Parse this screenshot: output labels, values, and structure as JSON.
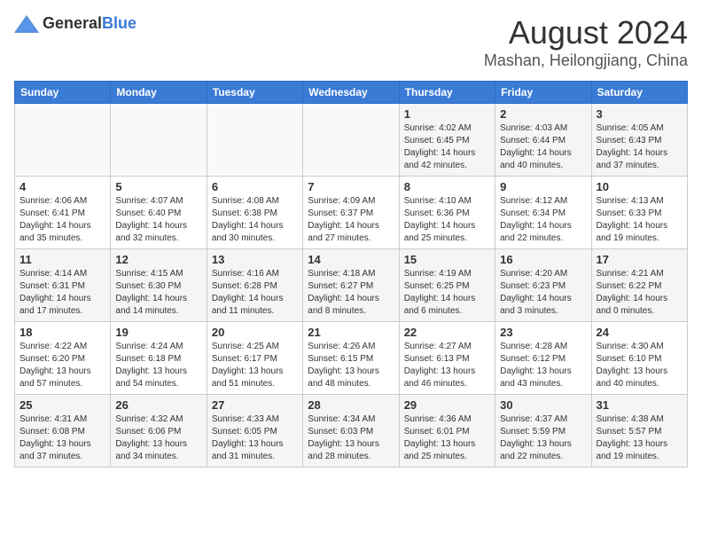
{
  "header": {
    "logo_general": "General",
    "logo_blue": "Blue",
    "month_year": "August 2024",
    "location": "Mashan, Heilongjiang, China"
  },
  "weekdays": [
    "Sunday",
    "Monday",
    "Tuesday",
    "Wednesday",
    "Thursday",
    "Friday",
    "Saturday"
  ],
  "weeks": [
    [
      {
        "day": "",
        "info": ""
      },
      {
        "day": "",
        "info": ""
      },
      {
        "day": "",
        "info": ""
      },
      {
        "day": "",
        "info": ""
      },
      {
        "day": "1",
        "info": "Sunrise: 4:02 AM\nSunset: 6:45 PM\nDaylight: 14 hours and 42 minutes."
      },
      {
        "day": "2",
        "info": "Sunrise: 4:03 AM\nSunset: 6:44 PM\nDaylight: 14 hours and 40 minutes."
      },
      {
        "day": "3",
        "info": "Sunrise: 4:05 AM\nSunset: 6:43 PM\nDaylight: 14 hours and 37 minutes."
      }
    ],
    [
      {
        "day": "4",
        "info": "Sunrise: 4:06 AM\nSunset: 6:41 PM\nDaylight: 14 hours and 35 minutes."
      },
      {
        "day": "5",
        "info": "Sunrise: 4:07 AM\nSunset: 6:40 PM\nDaylight: 14 hours and 32 minutes."
      },
      {
        "day": "6",
        "info": "Sunrise: 4:08 AM\nSunset: 6:38 PM\nDaylight: 14 hours and 30 minutes."
      },
      {
        "day": "7",
        "info": "Sunrise: 4:09 AM\nSunset: 6:37 PM\nDaylight: 14 hours and 27 minutes."
      },
      {
        "day": "8",
        "info": "Sunrise: 4:10 AM\nSunset: 6:36 PM\nDaylight: 14 hours and 25 minutes."
      },
      {
        "day": "9",
        "info": "Sunrise: 4:12 AM\nSunset: 6:34 PM\nDaylight: 14 hours and 22 minutes."
      },
      {
        "day": "10",
        "info": "Sunrise: 4:13 AM\nSunset: 6:33 PM\nDaylight: 14 hours and 19 minutes."
      }
    ],
    [
      {
        "day": "11",
        "info": "Sunrise: 4:14 AM\nSunset: 6:31 PM\nDaylight: 14 hours and 17 minutes."
      },
      {
        "day": "12",
        "info": "Sunrise: 4:15 AM\nSunset: 6:30 PM\nDaylight: 14 hours and 14 minutes."
      },
      {
        "day": "13",
        "info": "Sunrise: 4:16 AM\nSunset: 6:28 PM\nDaylight: 14 hours and 11 minutes."
      },
      {
        "day": "14",
        "info": "Sunrise: 4:18 AM\nSunset: 6:27 PM\nDaylight: 14 hours and 8 minutes."
      },
      {
        "day": "15",
        "info": "Sunrise: 4:19 AM\nSunset: 6:25 PM\nDaylight: 14 hours and 6 minutes."
      },
      {
        "day": "16",
        "info": "Sunrise: 4:20 AM\nSunset: 6:23 PM\nDaylight: 14 hours and 3 minutes."
      },
      {
        "day": "17",
        "info": "Sunrise: 4:21 AM\nSunset: 6:22 PM\nDaylight: 14 hours and 0 minutes."
      }
    ],
    [
      {
        "day": "18",
        "info": "Sunrise: 4:22 AM\nSunset: 6:20 PM\nDaylight: 13 hours and 57 minutes."
      },
      {
        "day": "19",
        "info": "Sunrise: 4:24 AM\nSunset: 6:18 PM\nDaylight: 13 hours and 54 minutes."
      },
      {
        "day": "20",
        "info": "Sunrise: 4:25 AM\nSunset: 6:17 PM\nDaylight: 13 hours and 51 minutes."
      },
      {
        "day": "21",
        "info": "Sunrise: 4:26 AM\nSunset: 6:15 PM\nDaylight: 13 hours and 48 minutes."
      },
      {
        "day": "22",
        "info": "Sunrise: 4:27 AM\nSunset: 6:13 PM\nDaylight: 13 hours and 46 minutes."
      },
      {
        "day": "23",
        "info": "Sunrise: 4:28 AM\nSunset: 6:12 PM\nDaylight: 13 hours and 43 minutes."
      },
      {
        "day": "24",
        "info": "Sunrise: 4:30 AM\nSunset: 6:10 PM\nDaylight: 13 hours and 40 minutes."
      }
    ],
    [
      {
        "day": "25",
        "info": "Sunrise: 4:31 AM\nSunset: 6:08 PM\nDaylight: 13 hours and 37 minutes."
      },
      {
        "day": "26",
        "info": "Sunrise: 4:32 AM\nSunset: 6:06 PM\nDaylight: 13 hours and 34 minutes."
      },
      {
        "day": "27",
        "info": "Sunrise: 4:33 AM\nSunset: 6:05 PM\nDaylight: 13 hours and 31 minutes."
      },
      {
        "day": "28",
        "info": "Sunrise: 4:34 AM\nSunset: 6:03 PM\nDaylight: 13 hours and 28 minutes."
      },
      {
        "day": "29",
        "info": "Sunrise: 4:36 AM\nSunset: 6:01 PM\nDaylight: 13 hours and 25 minutes."
      },
      {
        "day": "30",
        "info": "Sunrise: 4:37 AM\nSunset: 5:59 PM\nDaylight: 13 hours and 22 minutes."
      },
      {
        "day": "31",
        "info": "Sunrise: 4:38 AM\nSunset: 5:57 PM\nDaylight: 13 hours and 19 minutes."
      }
    ]
  ]
}
